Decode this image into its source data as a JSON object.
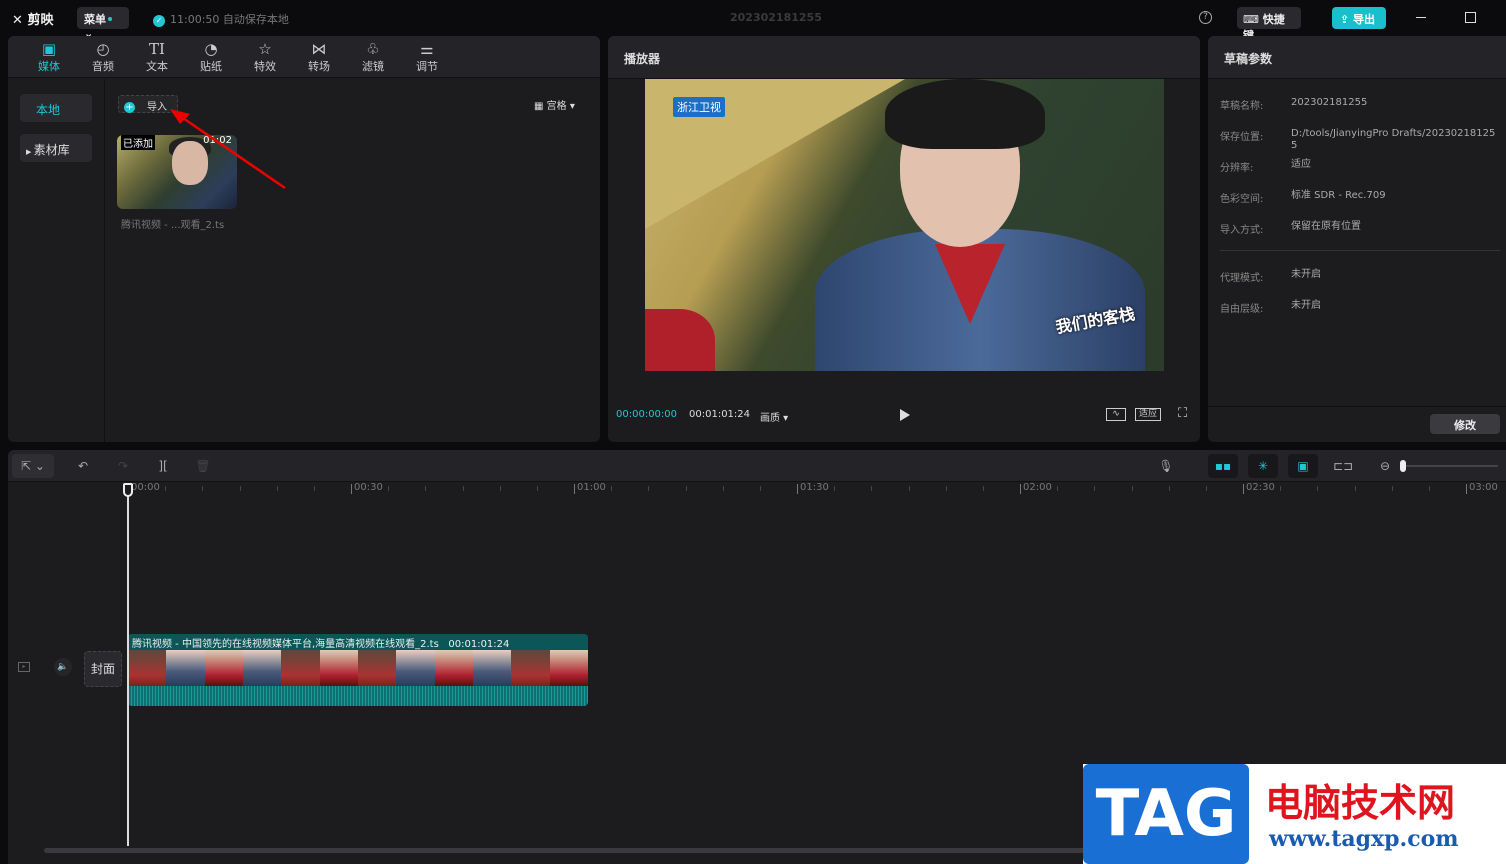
{
  "app": {
    "name": "剪映",
    "menu": "菜单",
    "autosave": "11:00:50 自动保存本地",
    "project_title": "202302181255",
    "shortcuts": "快捷键",
    "export": "导出",
    "help": "?"
  },
  "media_tools": [
    {
      "label": "媒体",
      "icon": "media-icon"
    },
    {
      "label": "音频",
      "icon": "audio-icon"
    },
    {
      "label": "文本",
      "icon": "text-icon",
      "glyph": "TI"
    },
    {
      "label": "贴纸",
      "icon": "sticker-icon"
    },
    {
      "label": "特效",
      "icon": "effects-icon"
    },
    {
      "label": "转场",
      "icon": "transition-icon"
    },
    {
      "label": "滤镜",
      "icon": "filter-icon"
    },
    {
      "label": "调节",
      "icon": "adjust-icon"
    }
  ],
  "media": {
    "sidebar": [
      "本地",
      "素材库"
    ],
    "import": "导入",
    "view": "宫格",
    "item": {
      "badge": "已添加",
      "duration": "01:02",
      "filename": "腾讯视频 - ...观看_2.ts"
    }
  },
  "player": {
    "title": "播放器",
    "current": "00:00:00:00",
    "total": "00:01:01:24",
    "quality": "画质",
    "fit": "适应",
    "video_watermark": "浙江卫视",
    "video_show": "我们的客栈"
  },
  "draft": {
    "title": "草稿参数",
    "rows": [
      {
        "k": "草稿名称:",
        "v": "202302181255"
      },
      {
        "k": "保存位置:",
        "v": "D:/tools/JianyingPro Drafts/202302181255"
      },
      {
        "k": "分辨率:",
        "v": "适应"
      },
      {
        "k": "色彩空间:",
        "v": "标准 SDR - Rec.709"
      },
      {
        "k": "导入方式:",
        "v": "保留在原有位置"
      },
      {
        "k": "代理模式:",
        "v": "未开启"
      },
      {
        "k": "自由层级:",
        "v": "未开启"
      }
    ],
    "modify": "修改"
  },
  "timeline": {
    "ruler": [
      "00:00",
      "00:30",
      "01:00",
      "01:30",
      "02:00",
      "02:30",
      "03:00"
    ],
    "cover": "封面",
    "clip": {
      "name": "腾讯视频 - 中国领先的在线视频媒体平台,海量高清视频在线观看_2.ts",
      "duration": "00:01:01:24"
    }
  },
  "watermark": {
    "logo": "TAG",
    "site": "电脑技术网",
    "url": "www.tagxp.com"
  }
}
